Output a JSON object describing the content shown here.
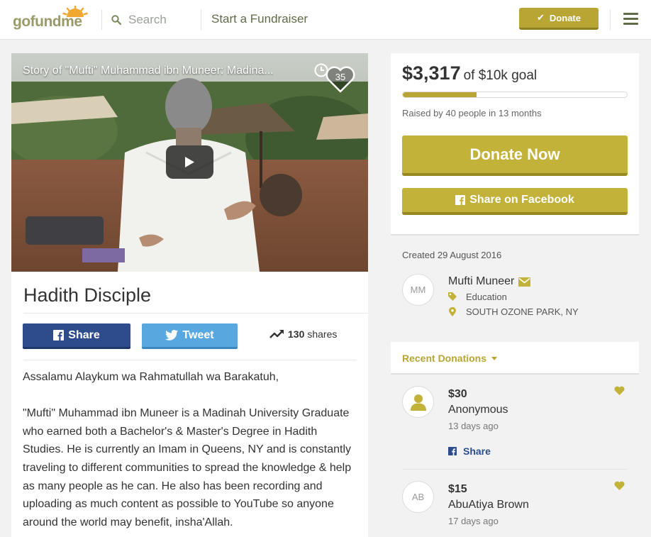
{
  "header": {
    "logo": {
      "go": "go",
      "fund": "fund",
      "me": "me"
    },
    "search_label": "Search",
    "start_label": "Start a Fundraiser",
    "donate_label": "Donate"
  },
  "video": {
    "title": "Story of \"Mufti\" Muhammad ibn Muneer: Madina...",
    "likes": "35"
  },
  "campaign": {
    "title": "Hadith Disciple",
    "share_label": "Share",
    "tweet_label": "Tweet",
    "shares_count": "130",
    "shares_label": "shares",
    "story": [
      "Assalamu Alaykum wa Rahmatullah wa Barakatuh,",
      "\"Mufti\" Muhammad ibn Muneer is a Madinah University Graduate who earned both a Bachelor's & Master's Degree in Hadith Studies.  He is currently an Imam in Queens, NY and is constantly traveling to different communities to spread the knowledge & help as many people as he can.  He also has been recording and uploading as much content as possible to YouTube so anyone around the world may benefit, insha'Allah."
    ]
  },
  "goal": {
    "raised_amount": "$3,317",
    "goal_text": "of $10k goal",
    "progress_fraction": 0.33,
    "raised_text": "Raised by 40 people in 13 months",
    "donate_now_label": "Donate Now",
    "share_fb_label": "Share on Facebook"
  },
  "organizer": {
    "created": "Created 29 August 2016",
    "initials": "MM",
    "name": "Mufti Muneer",
    "category": "Education",
    "location": "SOUTH OZONE PARK, NY"
  },
  "recent": {
    "label": "Recent Donations",
    "donations": [
      {
        "amount": "$30",
        "name": "Anonymous",
        "time": "13 days ago",
        "share_label": "Share"
      },
      {
        "amount": "$15",
        "name": "AbuAtiya Brown",
        "time": "17 days ago",
        "initials": "AB"
      }
    ]
  },
  "colors": {
    "accent": "#b8a533",
    "facebook": "#2e4b8b",
    "twitter": "#58a7df",
    "nav_text": "#5f6b48"
  }
}
